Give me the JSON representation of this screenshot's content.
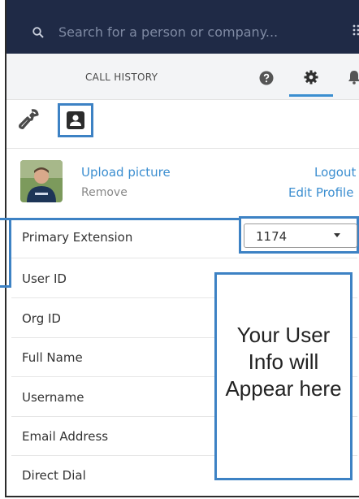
{
  "search": {
    "placeholder": "Search for a person or company..."
  },
  "tabs": {
    "call_history": "CALL HISTORY"
  },
  "profile": {
    "upload_picture": "Upload picture",
    "remove": "Remove",
    "logout": "Logout",
    "edit_profile": "Edit Profile"
  },
  "fields": {
    "primary_extension": "Primary Extension",
    "user_id": "User ID",
    "org_id": "Org ID",
    "full_name": "Full Name",
    "username": "Username",
    "email_address": "Email Address",
    "direct_dial": "Direct Dial"
  },
  "extension_select": {
    "value": "1174"
  },
  "callout": {
    "text": "Your User Info will Appear here"
  },
  "icons": {
    "search": "search-icon",
    "apps": "grid-icon",
    "help": "help-icon",
    "settings": "gear-icon",
    "notifications": "bell-icon",
    "tools": "wrench-icon",
    "contact": "contact-card-icon"
  },
  "colors": {
    "navy": "#1f2a46",
    "accent": "#3b8ed0",
    "highlight": "#3d82c4"
  }
}
